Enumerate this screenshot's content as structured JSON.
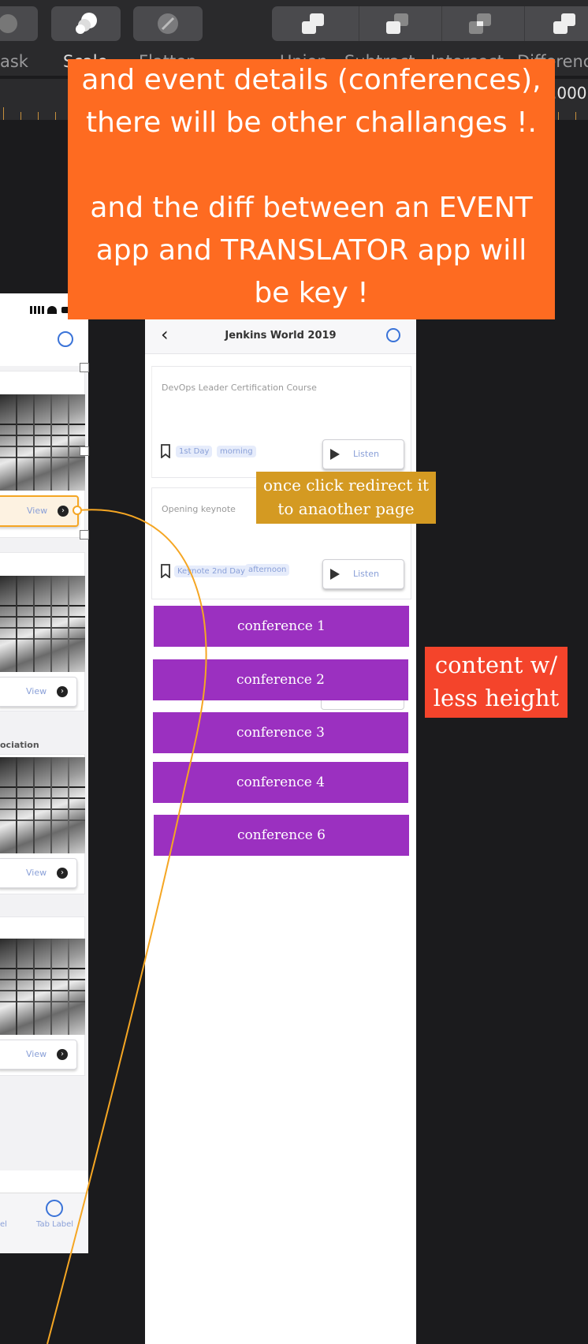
{
  "toolbar": {
    "labels": [
      "ask",
      "Scale",
      "Flatten",
      "Union",
      "Subtract",
      "Intersect",
      "Difference"
    ],
    "ruler_value": ".000"
  },
  "left_phone": {
    "view_label": "View",
    "section_label": "ociation",
    "tab_label": "Tab Label",
    "tab_label_cut": "el"
  },
  "event_screen": {
    "title": "Jenkins World 2019",
    "sessions": [
      {
        "title": "DevOps Leader Certification Course",
        "tags": [
          "1st Day",
          "morning"
        ],
        "action": "Listen"
      },
      {
        "title": "Opening keynote",
        "tags": [
          "Keynote",
          "2nd Day",
          "afternoon"
        ],
        "action": "Listen"
      }
    ],
    "conferences": [
      "conference 1",
      "conference 2",
      "conference 3",
      "conference 4",
      "conference 6"
    ]
  },
  "annotations": {
    "orange_banner": [
      "and event details (conferences),",
      "there will be other challanges !.",
      "",
      "and the diff between an EVENT",
      "app and TRANSLATOR app will",
      "be key !"
    ],
    "yellow_note": [
      "once click redirect it",
      "to anaother page"
    ],
    "red_note": [
      "content w/",
      "less height"
    ]
  },
  "colors": {
    "banner": "#fe6b21",
    "yellow_note": "#d49a22",
    "red_note": "#f4442b",
    "conference": "#9b30c0",
    "connector": "#f5a623"
  }
}
